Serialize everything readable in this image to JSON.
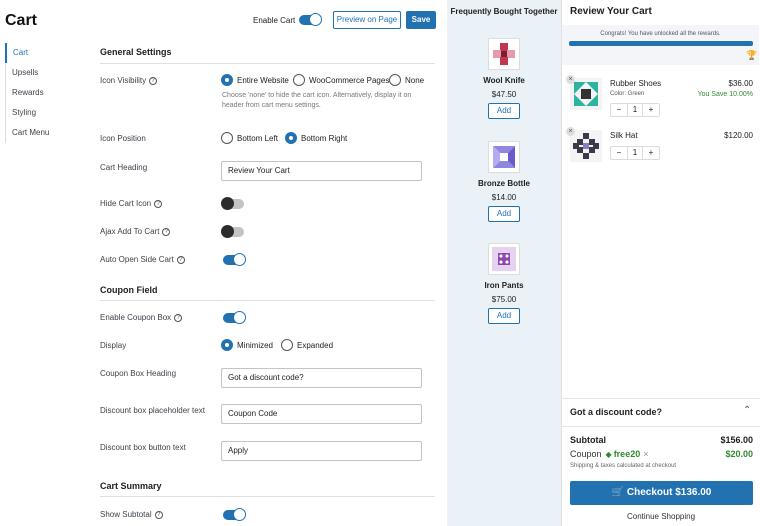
{
  "page": {
    "title": "Cart"
  },
  "sidebar": {
    "items": [
      {
        "label": "Cart",
        "active": true
      },
      {
        "label": "Upsells"
      },
      {
        "label": "Rewards"
      },
      {
        "label": "Styling"
      },
      {
        "label": "Cart Menu"
      }
    ]
  },
  "topbar": {
    "enable_label": "Enable Cart",
    "enable_on": true,
    "preview_label": "Preview on Page",
    "save_label": "Save"
  },
  "general": {
    "heading": "General Settings",
    "icon_visibility": {
      "label": "Icon Visibility",
      "options": [
        "Entire Website",
        "WooCommerce Pages",
        "None"
      ],
      "selected": "Entire Website",
      "hint": "Choose 'none' to hide the cart icon. Alternatively, display it on header from cart menu settings."
    },
    "icon_position": {
      "label": "Icon Position",
      "options": [
        "Bottom Left",
        "Bottom Right"
      ],
      "selected": "Bottom Right"
    },
    "cart_heading": {
      "label": "Cart Heading",
      "value": "Review Your Cart"
    },
    "hide_cart_icon": {
      "label": "Hide Cart Icon",
      "on": false
    },
    "ajax_add": {
      "label": "Ajax Add To Cart",
      "on": false
    },
    "auto_open": {
      "label": "Auto Open Side Cart",
      "on": true
    }
  },
  "coupon": {
    "heading": "Coupon Field",
    "enable": {
      "label": "Enable Coupon Box",
      "on": true
    },
    "display": {
      "label": "Display",
      "options": [
        "Minimized",
        "Expanded"
      ],
      "selected": "Minimized"
    },
    "box_heading": {
      "label": "Coupon Box Heading",
      "value": "Got a discount code?"
    },
    "placeholder": {
      "label": "Discount box placeholder text",
      "value": "Coupon Code"
    },
    "button_text": {
      "label": "Discount box button text",
      "value": "Apply"
    }
  },
  "summary": {
    "heading": "Cart Summary",
    "show_subtotal": {
      "label": "Show Subtotal",
      "on": true
    }
  },
  "fbt": {
    "title": "Frequently Bought Together",
    "products": [
      {
        "name": "Wool Knife",
        "price": "$47.50",
        "add": "Add",
        "color": "#c0374f"
      },
      {
        "name": "Bronze Bottle",
        "price": "$14.00",
        "add": "Add",
        "color": "#6a5acd"
      },
      {
        "name": "Iron Pants",
        "price": "$75.00",
        "add": "Add",
        "color": "#8e44ad"
      }
    ]
  },
  "cart": {
    "title": "Review Your Cart",
    "reward_text": "Congrats! You have unlocked all the rewards.",
    "reward_progress": 1.0,
    "items": [
      {
        "name": "Rubber Shoes",
        "variant": "Color: Green",
        "price": "$36.00",
        "save": "You Save 10.00%",
        "qty": "1",
        "color": "#2bb5a0"
      },
      {
        "name": "Silk Hat",
        "variant": "",
        "price": "$120.00",
        "save": "",
        "qty": "1",
        "color": "#3a3a4a"
      }
    ],
    "qty_minus": "−",
    "qty_plus": "+",
    "discount_heading": "Got a discount code?",
    "subtotal_label": "Subtotal",
    "subtotal_value": "$156.00",
    "coupon_label": "Coupon",
    "coupon_code": "free20",
    "coupon_value": "$20.00",
    "shipping_note": "Shipping & taxes calculated at checkout",
    "checkout_label": "Checkout",
    "checkout_total": "$136.00",
    "continue_label": "Continue Shopping"
  }
}
